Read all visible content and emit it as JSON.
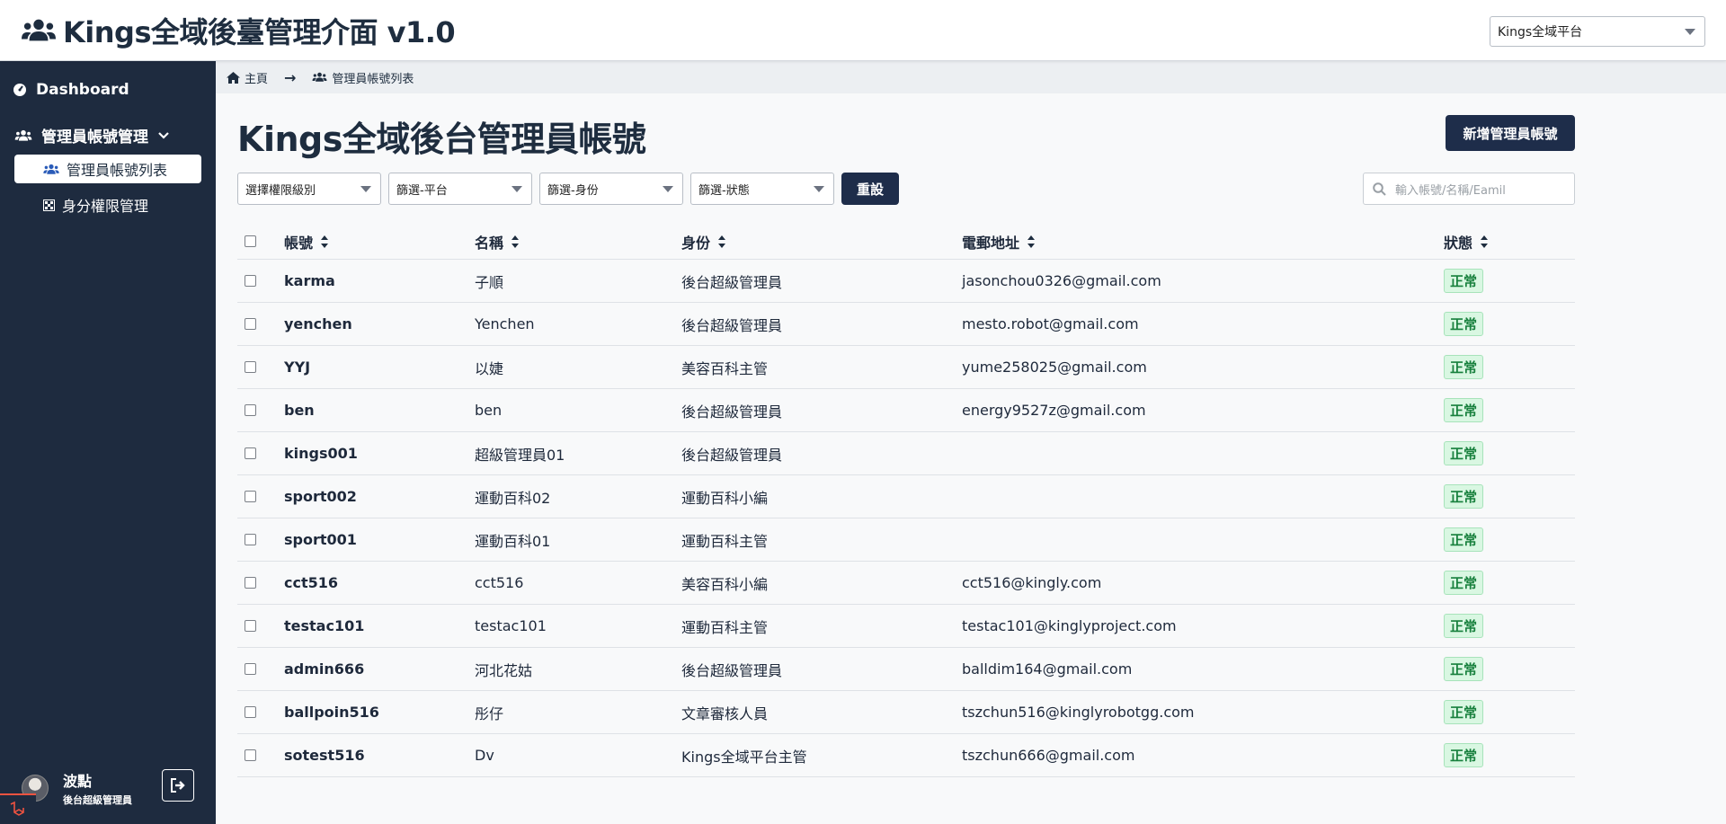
{
  "app": {
    "title": "Kings全域後臺管理介面 v1.0"
  },
  "platform_select": {
    "value": "Kings全域平台"
  },
  "sidebar": {
    "dashboard_label": "Dashboard",
    "admin_group_label": "管理員帳號管理",
    "items": [
      {
        "label": "管理員帳號列表",
        "active": true
      },
      {
        "label": "身分權限管理",
        "active": false
      }
    ]
  },
  "user": {
    "name": "波點",
    "role": "後台超級管理員"
  },
  "breadcrumb": {
    "home": "主頁",
    "current": "管理員帳號列表"
  },
  "page": {
    "title": "Kings全域後台管理員帳號",
    "add_button": "新增管理員帳號"
  },
  "filters": {
    "level": "選擇權限級別",
    "platform": "篩選-平台",
    "role": "篩選-身份",
    "status": "篩選-狀態",
    "reset": "重設",
    "search_placeholder": "輸入帳號/名稱/Eamil"
  },
  "table": {
    "headers": {
      "account": "帳號",
      "name": "名稱",
      "role": "身份",
      "email": "電郵地址",
      "status": "狀態"
    },
    "rows": [
      {
        "account": "karma",
        "name": "子順",
        "role": "後台超級管理員",
        "email": "jasonchou0326@gmail.com",
        "status": "正常"
      },
      {
        "account": "yenchen",
        "name": "Yenchen",
        "role": "後台超級管理員",
        "email": "mesto.robot@gmail.com",
        "status": "正常"
      },
      {
        "account": "YYJ",
        "name": "以婕",
        "role": "美容百科主管",
        "email": "yume258025@gmail.com",
        "status": "正常"
      },
      {
        "account": "ben",
        "name": "ben",
        "role": "後台超級管理員",
        "email": "energy9527z@gmail.com",
        "status": "正常"
      },
      {
        "account": "kings001",
        "name": "超級管理員01",
        "role": "後台超級管理員",
        "email": "",
        "status": "正常"
      },
      {
        "account": "sport002",
        "name": "運動百科02",
        "role": "運動百科小編",
        "email": "",
        "status": "正常"
      },
      {
        "account": "sport001",
        "name": "運動百科01",
        "role": "運動百科主管",
        "email": "",
        "status": "正常"
      },
      {
        "account": "cct516",
        "name": "cct516",
        "role": "美容百科小編",
        "email": "cct516@kingly.com",
        "status": "正常"
      },
      {
        "account": "testac101",
        "name": "testac101",
        "role": "運動百科主管",
        "email": "testac101@kinglyproject.com",
        "status": "正常"
      },
      {
        "account": "admin666",
        "name": "河北花姑",
        "role": "後台超級管理員",
        "email": "balldim164@gmail.com",
        "status": "正常"
      },
      {
        "account": "ballpoin516",
        "name": "彤仔",
        "role": "文章審核人員",
        "email": "tszchun516@kinglyrobotgg.com",
        "status": "正常"
      },
      {
        "account": "sotest516",
        "name": "Dv",
        "role": "Kings全域平台主管",
        "email": "tszchun666@gmail.com",
        "status": "正常"
      }
    ]
  },
  "icons": {
    "users": "users-icon",
    "dashboard": "gauge-icon",
    "chevron": "chevron-down-icon",
    "home": "home-icon",
    "search": "search-icon",
    "sort": "sort-icon",
    "logout": "logout-icon",
    "permissions": "grid-icon"
  },
  "colors": {
    "sidebar": "#1e2b3f",
    "primary_button": "#1e2d4a",
    "status_ok_bg": "#d9f7e2",
    "status_ok_text": "#17803d"
  }
}
